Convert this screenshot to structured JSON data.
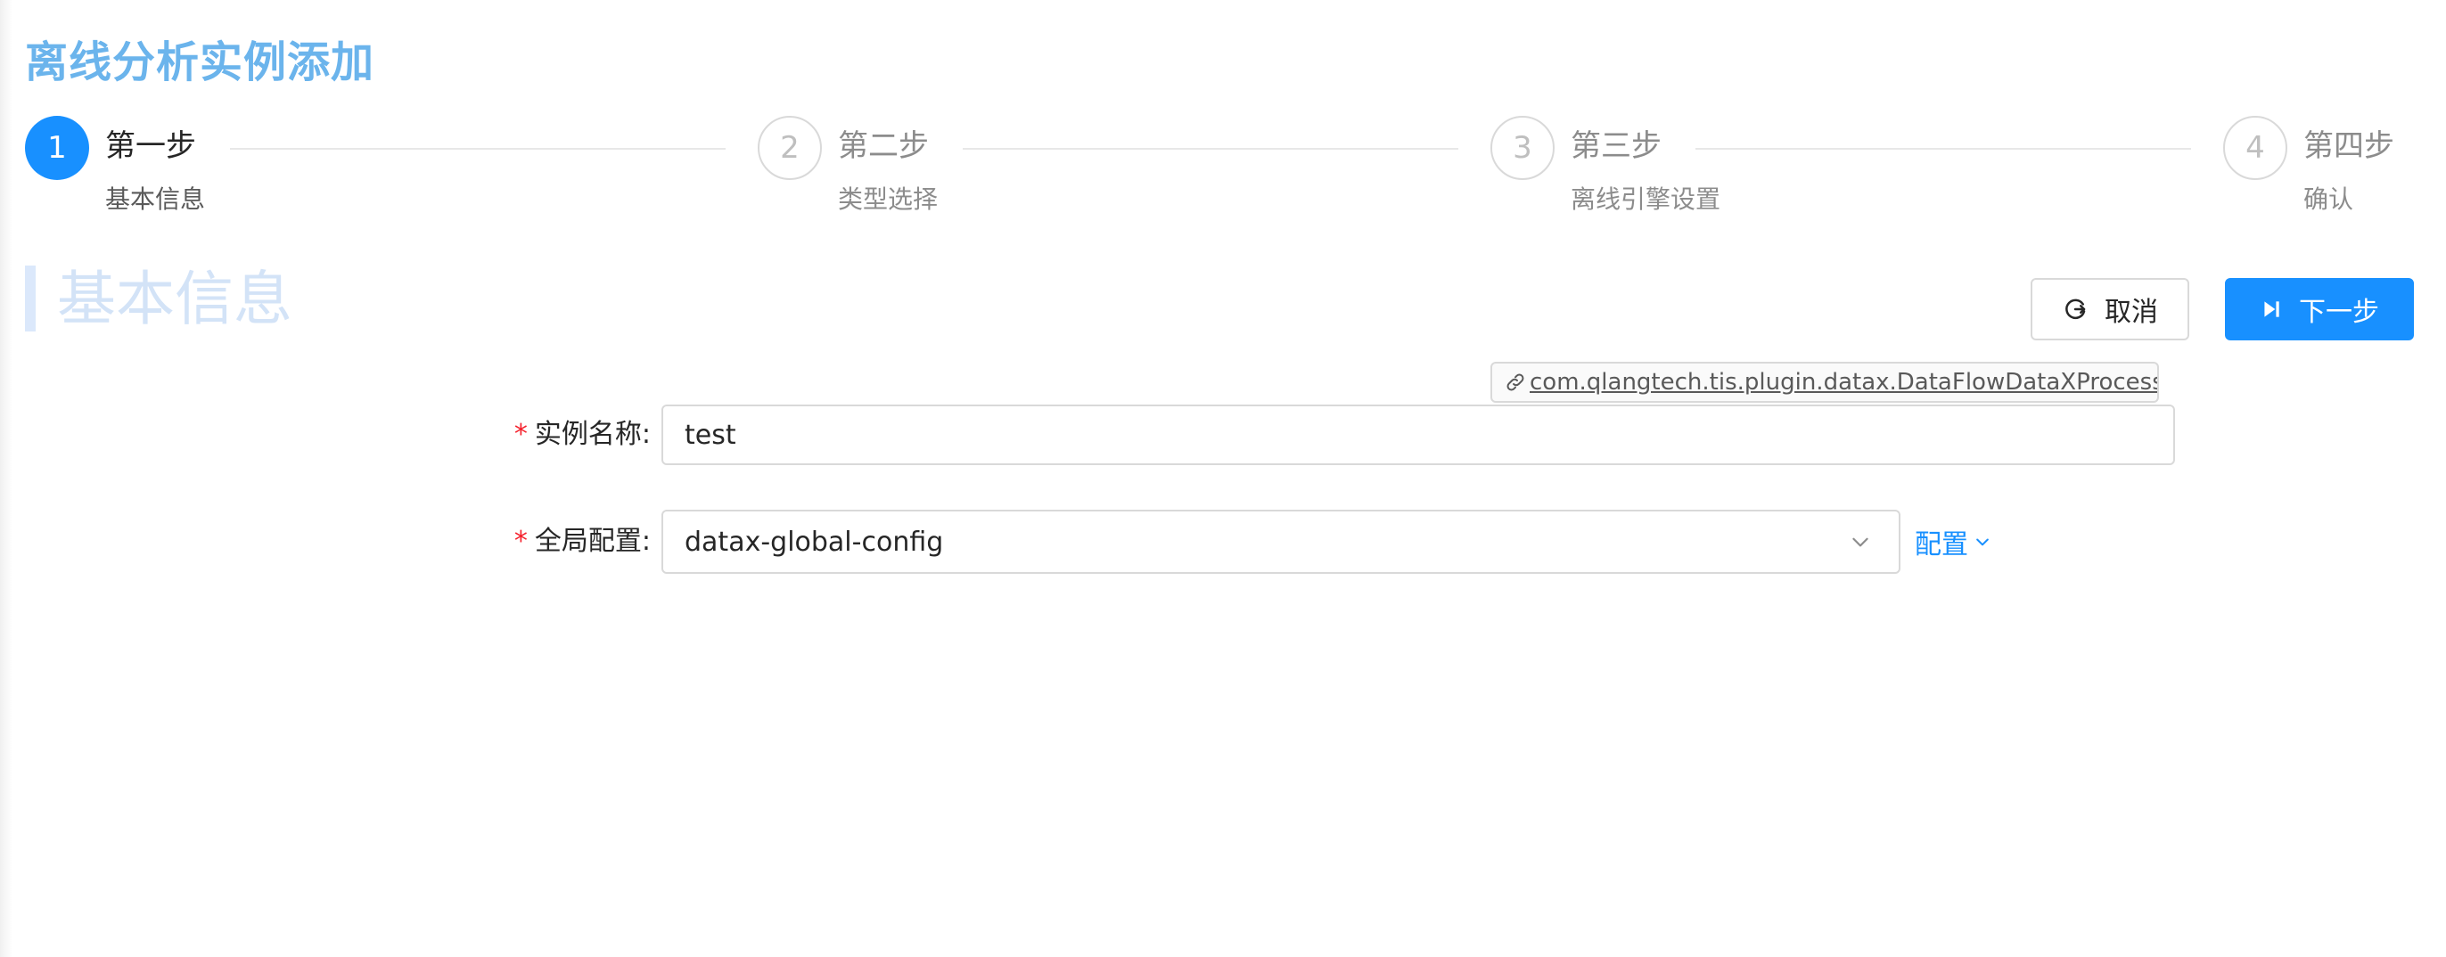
{
  "page": {
    "title": "离线分析实例添加"
  },
  "steps": [
    {
      "number": "1",
      "title": "第一步",
      "description": "基本信息",
      "status": "active"
    },
    {
      "number": "2",
      "title": "第二步",
      "description": "类型选择",
      "status": "wait"
    },
    {
      "number": "3",
      "title": "第三步",
      "description": "离线引擎设置",
      "status": "wait"
    },
    {
      "number": "4",
      "title": "第四步",
      "description": "确认",
      "status": "wait"
    }
  ],
  "section": {
    "title": "基本信息"
  },
  "toolbar": {
    "cancel_label": "取消",
    "next_label": "下一步"
  },
  "plugin": {
    "class_name": "com.qlangtech.tis.plugin.datax.DataFlowDataXProcessor",
    "icon": "link-icon"
  },
  "form": {
    "required_mark": "*",
    "instance_name": {
      "label": "实例名称:",
      "value": "test"
    },
    "global_config": {
      "label": "全局配置:",
      "value": "datax-global-config",
      "config_link_label": "配置"
    }
  },
  "colors": {
    "primary": "#1890ff",
    "title": "#6bb4ec",
    "required": "#f5222d",
    "border": "#d9d9d9"
  }
}
